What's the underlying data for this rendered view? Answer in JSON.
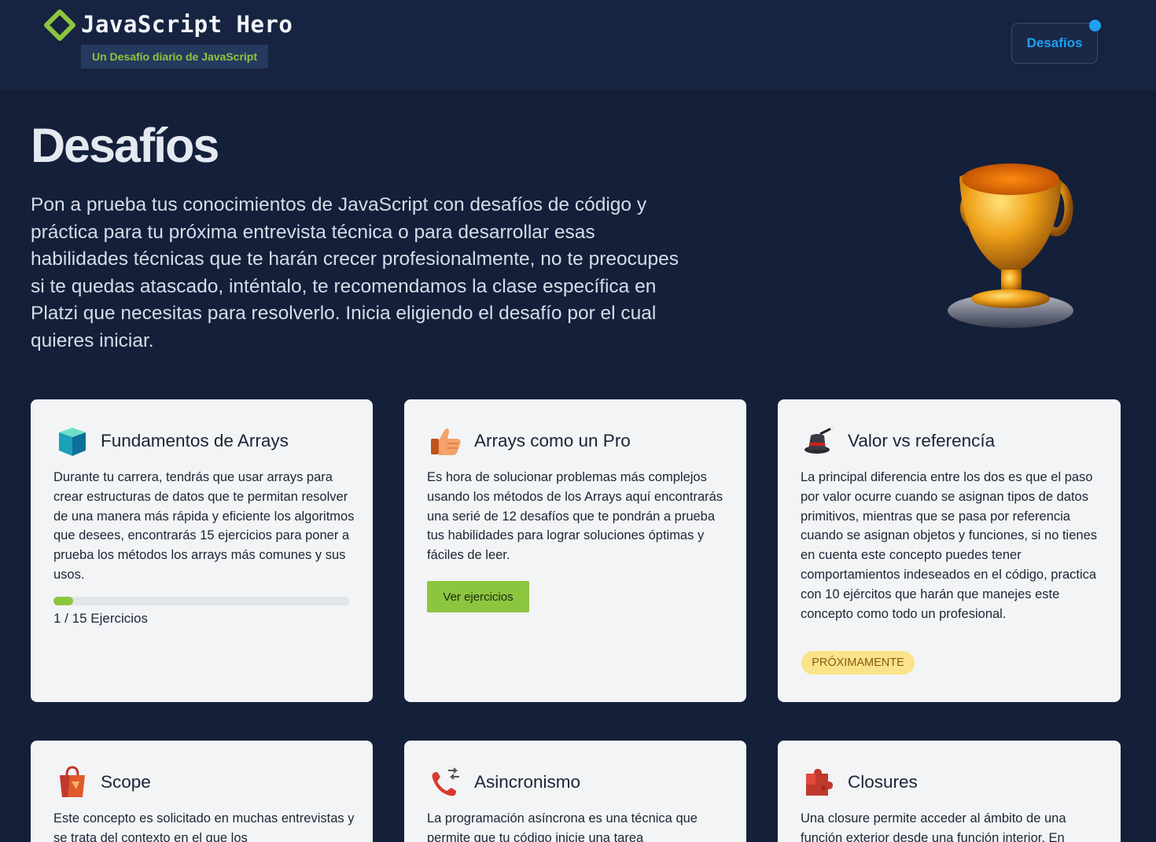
{
  "header": {
    "brand": "JavaScript Hero",
    "tagline": "Un Desafío diario de JavaScript",
    "nav_label": "Desafíos"
  },
  "hero": {
    "title": "Desafíos",
    "description": "Pon a prueba tus conocimientos de JavaScript con desafíos de código y práctica para tu próxima entrevista técnica o para desarrollar esas habilidades técnicas que te harán crecer profesionalmente, no te preocupes si te quedas atascado, inténtalo, te recomendamos la clase específica en Platzi que necesitas para resolverlo. Inicia eligiendo el desafío por el cual quieres iniciar."
  },
  "cards": [
    {
      "icon": "cube-icon",
      "title": "Fundamentos de Arrays",
      "description": "Durante tu carrera, tendrás que usar arrays para crear estructuras de datos que te permitan resolver de una manera más rápida y eficiente los algoritmos que desees, encontrarás 15 ejercicios para poner a prueba los métodos los arrays más comunes y sus usos.",
      "progress": {
        "done": 1,
        "total": 15,
        "label": "1 / 15 Ejercicios"
      }
    },
    {
      "icon": "thumbs-up-icon",
      "title": "Arrays como un Pro",
      "description": "Es hora de solucionar problemas más complejos usando los métodos de los Arrays aquí encontrarás una serié de 12 desafíos que te pondrán a prueba tus habilidades para lograr soluciones óptimas y fáciles de leer.",
      "button": "Ver ejercicios"
    },
    {
      "icon": "magic-hat-icon",
      "title": "Valor vs referencía",
      "description": "La principal diferencia entre los dos es que el paso por valor ocurre cuando se asignan tipos de datos primitivos, mientras que se pasa por referencia cuando se asignan objetos y funciones, si no tienes en cuenta este concepto puedes tener comportamientos indeseados en el código, practica con 10 ejércitos que harán que manejes este concepto como todo un profesional.",
      "badge": "PRÓXIMAMENTE"
    },
    {
      "icon": "shopping-bag-icon",
      "title": "Scope",
      "description": "Este concepto es solicitado en muchas entrevistas y se trata del contexto en el que los"
    },
    {
      "icon": "phone-icon",
      "title": "Asincronismo",
      "description": "La programación asíncrona es una técnica que permite que tu código inicie una tarea"
    },
    {
      "icon": "puzzle-icon",
      "title": "Closures",
      "description": "Una closure permite acceder al ámbito de una función exterior desde una función interior. En"
    }
  ]
}
